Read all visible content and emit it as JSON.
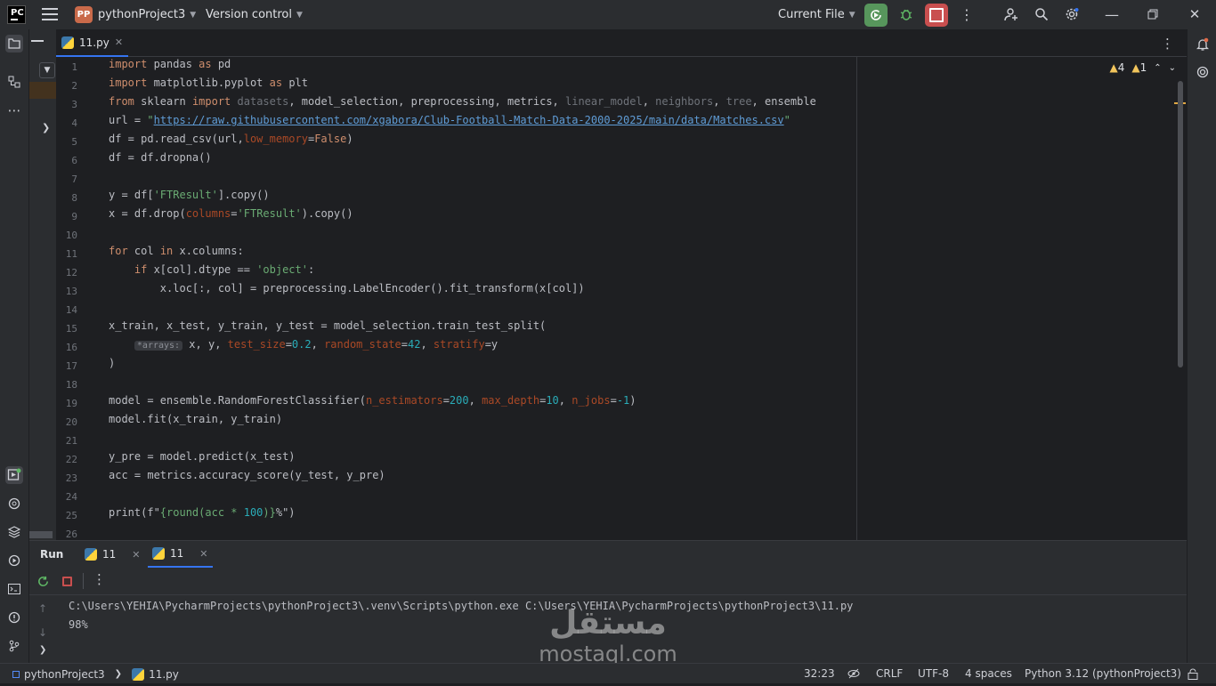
{
  "titlebar": {
    "project_badge": "PP",
    "project_name": "pythonProject3",
    "vcs": "Version control",
    "run_config": "Current File"
  },
  "editor": {
    "tab_label": "11.py",
    "inspections": {
      "warnings": "4",
      "weak_warnings": "1"
    },
    "line_numbers": [
      "1",
      "2",
      "3",
      "4",
      "5",
      "6",
      "7",
      "8",
      "9",
      "10",
      "11",
      "12",
      "13",
      "14",
      "15",
      "16",
      "17",
      "18",
      "19",
      "20",
      "21",
      "22",
      "23",
      "24",
      "25",
      "26"
    ],
    "lines": [
      [
        {
          "t": "import",
          "c": "kw"
        },
        {
          "t": " pandas "
        },
        {
          "t": "as",
          "c": "kw"
        },
        {
          "t": " pd"
        }
      ],
      [
        {
          "t": "import",
          "c": "kw"
        },
        {
          "t": " matplotlib.pyplot "
        },
        {
          "t": "as",
          "c": "kw"
        },
        {
          "t": " plt"
        }
      ],
      [
        {
          "t": "from",
          "c": "kw"
        },
        {
          "t": " sklearn "
        },
        {
          "t": "import",
          "c": "kw"
        },
        {
          "t": " "
        },
        {
          "t": "datasets",
          "c": "dim"
        },
        {
          "t": ", model_selection, preprocessing, metrics, "
        },
        {
          "t": "linear_model",
          "c": "dim"
        },
        {
          "t": ", "
        },
        {
          "t": "neighbors",
          "c": "dim"
        },
        {
          "t": ", "
        },
        {
          "t": "tree",
          "c": "dim"
        },
        {
          "t": ", ensemble"
        }
      ],
      [
        {
          "t": "url = "
        },
        {
          "t": "\"",
          "c": "str"
        },
        {
          "t": "https://raw.githubusercontent.com/xgabora/Club-Football-Match-Data-2000-2025/main/data/Matches.csv",
          "c": "url"
        },
        {
          "t": "\"",
          "c": "str"
        }
      ],
      [
        {
          "t": "df = pd.read_csv(url,"
        },
        {
          "t": "low_memory",
          "c": "par"
        },
        {
          "t": "="
        },
        {
          "t": "False",
          "c": "kw"
        },
        {
          "t": ")"
        }
      ],
      [
        {
          "t": "df = df.dropna()"
        }
      ],
      [],
      [
        {
          "t": "y = df["
        },
        {
          "t": "'FTResult'",
          "c": "str"
        },
        {
          "t": "].copy()"
        }
      ],
      [
        {
          "t": "x = df.drop("
        },
        {
          "t": "columns",
          "c": "par"
        },
        {
          "t": "="
        },
        {
          "t": "'FTResult'",
          "c": "str"
        },
        {
          "t": ").copy()"
        }
      ],
      [],
      [
        {
          "t": "for",
          "c": "kw"
        },
        {
          "t": " col "
        },
        {
          "t": "in",
          "c": "kw"
        },
        {
          "t": " x.columns:"
        }
      ],
      [
        {
          "t": "    "
        },
        {
          "t": "if",
          "c": "kw"
        },
        {
          "t": " x[col].dtype == "
        },
        {
          "t": "'object'",
          "c": "str"
        },
        {
          "t": ":"
        }
      ],
      [
        {
          "t": "        x.loc[:, col] = preprocessing.LabelEncoder().fit_transform(x[col])"
        }
      ],
      [],
      [
        {
          "t": "x_train, x_test, y_train, y_test = model_selection.train_test_split("
        }
      ],
      [
        {
          "t": "    "
        },
        {
          "t": "*arrays:",
          "c": "hint"
        },
        {
          "t": " x, y, "
        },
        {
          "t": "test_size",
          "c": "par"
        },
        {
          "t": "="
        },
        {
          "t": "0.2",
          "c": "num"
        },
        {
          "t": ", "
        },
        {
          "t": "random_state",
          "c": "par"
        },
        {
          "t": "="
        },
        {
          "t": "42",
          "c": "num"
        },
        {
          "t": ", "
        },
        {
          "t": "stratify",
          "c": "par"
        },
        {
          "t": "=y"
        }
      ],
      [
        {
          "t": ")"
        }
      ],
      [],
      [
        {
          "t": "model = ensemble.RandomForestClassifier("
        },
        {
          "t": "n_estimators",
          "c": "par"
        },
        {
          "t": "="
        },
        {
          "t": "200",
          "c": "num"
        },
        {
          "t": ", "
        },
        {
          "t": "max_depth",
          "c": "par"
        },
        {
          "t": "="
        },
        {
          "t": "10",
          "c": "num"
        },
        {
          "t": ", "
        },
        {
          "t": "n_jobs",
          "c": "par"
        },
        {
          "t": "="
        },
        {
          "t": "-1",
          "c": "num"
        },
        {
          "t": ")"
        }
      ],
      [
        {
          "t": "model.fit(x_train, y_train)"
        }
      ],
      [],
      [
        {
          "t": "y_pre = model.predict(x_test)"
        }
      ],
      [
        {
          "t": "acc = metrics.accuracy_score(y_test, y_pre)"
        }
      ],
      [],
      [
        {
          "t": "print(f\""
        },
        {
          "t": "{round(acc * ",
          "c": "str"
        },
        {
          "t": "100",
          "c": "num"
        },
        {
          "t": ")}",
          "c": "str"
        },
        {
          "t": "%\")"
        }
      ],
      []
    ]
  },
  "run_panel": {
    "title": "Run",
    "tabs": [
      "11",
      "11"
    ],
    "console": [
      "C:\\Users\\YEHIA\\PycharmProjects\\pythonProject3\\.venv\\Scripts\\python.exe C:\\Users\\YEHIA\\PycharmProjects\\pythonProject3\\11.py",
      "98%"
    ]
  },
  "statusbar": {
    "project": "pythonProject3",
    "file": "11.py",
    "position": "32:23",
    "line_sep": "CRLF",
    "encoding": "UTF-8",
    "indent": "4 spaces",
    "interpreter": "Python 3.12 (pythonProject3)"
  },
  "watermark": {
    "arabic": "مستقل",
    "latin": "mostaql.com"
  }
}
